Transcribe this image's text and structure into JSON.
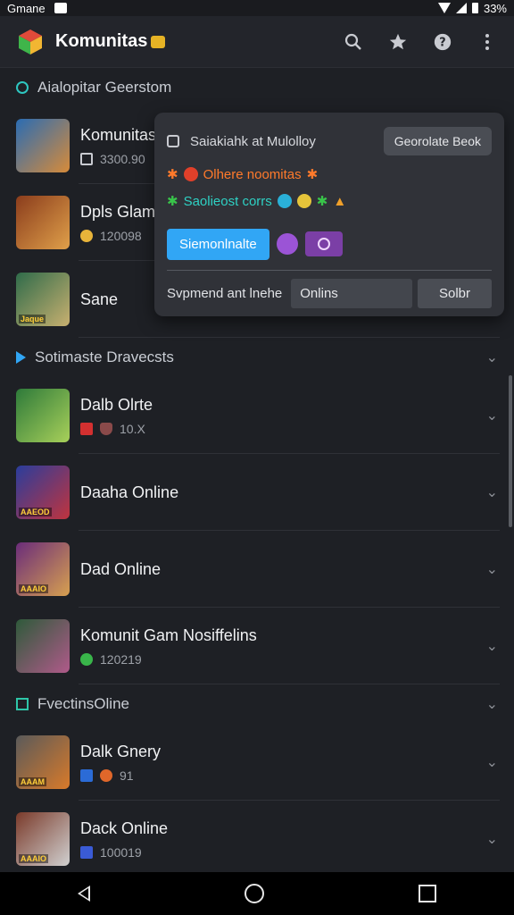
{
  "status": {
    "carrier": "Gmane",
    "battery": "33%"
  },
  "app": {
    "title": "Komunitas"
  },
  "sections": [
    {
      "title": "Aialopitar Geerstom",
      "marker_color": "#2ec6c0",
      "rows": [
        {
          "name": "Komunitas",
          "meta": "3300.90",
          "meta_color": "#c9cbd1",
          "thumb": [
            "#2a6cb3",
            "#d78b3a"
          ]
        },
        {
          "name": "Dpls Glam",
          "meta": "120098",
          "meta_color": "#e8b43a",
          "thumb": [
            "#8a3c1c",
            "#e0a04a"
          ]
        },
        {
          "name": "Sane",
          "meta": "",
          "meta_color": "",
          "thumb": [
            "#2f6b4a",
            "#c8b070"
          ],
          "tag": "Jaque"
        }
      ]
    },
    {
      "title": "Sotimaste Dravecsts",
      "marker_color": "#31a6f5",
      "rows": [
        {
          "name": "Dalb Olrte",
          "meta": "10.X",
          "meta_color": "#d33030",
          "thumb": [
            "#2e7a3a",
            "#a8d05a"
          ]
        },
        {
          "name": "Daaha Online",
          "meta": "",
          "meta_color": "",
          "thumb": [
            "#2a3d9c",
            "#c0343e"
          ],
          "tag": "AAEOD"
        },
        {
          "name": "Dad Online",
          "meta": "",
          "meta_color": "",
          "thumb": [
            "#6a2c7a",
            "#d7a050"
          ],
          "tag": "AAAIO"
        },
        {
          "name": "Komunit Gam Nosiffelins",
          "meta": "120219",
          "meta_color": "#39b54a",
          "thumb": [
            "#2e5a3a",
            "#b05a8a"
          ]
        }
      ]
    },
    {
      "title": "FvectinsOline",
      "marker_color": "#2ec6a8",
      "rows": [
        {
          "name": "Dalk Gnery",
          "meta": "91",
          "meta_color": "#2b6bd6",
          "thumb": [
            "#5a5a5a",
            "#d87a2a"
          ],
          "tag": "AAAM"
        },
        {
          "name": "Dack Online",
          "meta": "100019",
          "meta_color": "#3a5bd6",
          "thumb": [
            "#7a3a2a",
            "#d0d0d0"
          ],
          "tag": "AAAIO"
        }
      ]
    }
  ],
  "popup": {
    "header_label": "Saiakiahk at Mulolloy",
    "header_button": "Georolate Beok",
    "line_orange": "Olhere noomitas",
    "line_teal": "Saolieost corrs",
    "primary_button": "Siemonlnalte",
    "input_label": "Svpmend ant lnehe",
    "input_value": "Onlins",
    "submit_button": "Solbr"
  }
}
